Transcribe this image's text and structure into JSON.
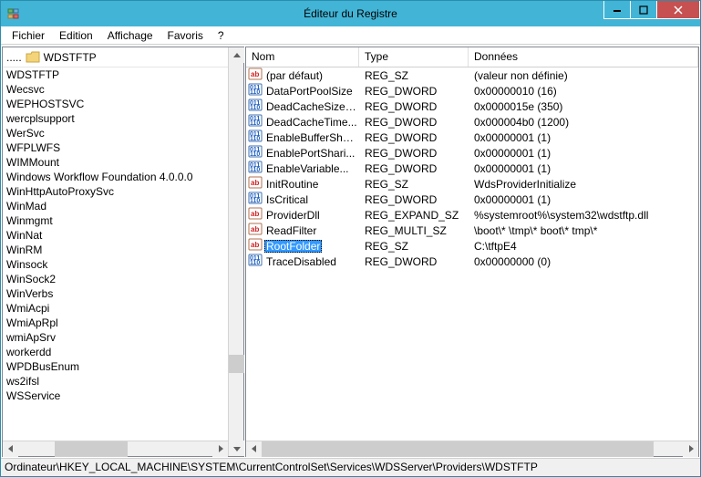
{
  "window": {
    "title": "Éditeur du Registre"
  },
  "menu": {
    "items": [
      "Fichier",
      "Edition",
      "Affichage",
      "Favoris",
      "?"
    ]
  },
  "tree": {
    "header_dots": ".....",
    "selected_key": "WDSTFTP",
    "nodes": [
      "WDSTFTP",
      "Wecsvc",
      "WEPHOSTSVC",
      "wercplsupport",
      "WerSvc",
      "WFPLWFS",
      "WIMMount",
      "Windows Workflow Foundation 4.0.0.0",
      "WinHttpAutoProxySvc",
      "WinMad",
      "Winmgmt",
      "WinNat",
      "WinRM",
      "Winsock",
      "WinSock2",
      "WinVerbs",
      "WmiAcpi",
      "WmiApRpl",
      "wmiApSrv",
      "workerdd",
      "WPDBusEnum",
      "ws2ifsl",
      "WSService"
    ]
  },
  "values": {
    "columns": {
      "name": "Nom",
      "type": "Type",
      "data": "Données"
    },
    "rows": [
      {
        "icon": "sz",
        "name": "(par défaut)",
        "type": "REG_SZ",
        "data": "(valeur non définie)",
        "selected": false
      },
      {
        "icon": "bin",
        "name": "DataPortPoolSize",
        "type": "REG_DWORD",
        "data": "0x00000010 (16)",
        "selected": false
      },
      {
        "icon": "bin",
        "name": "DeadCacheSizeL...",
        "type": "REG_DWORD",
        "data": "0x0000015e (350)",
        "selected": false
      },
      {
        "icon": "bin",
        "name": "DeadCacheTime...",
        "type": "REG_DWORD",
        "data": "0x000004b0 (1200)",
        "selected": false
      },
      {
        "icon": "bin",
        "name": "EnableBufferSha...",
        "type": "REG_DWORD",
        "data": "0x00000001 (1)",
        "selected": false
      },
      {
        "icon": "bin",
        "name": "EnablePortShari...",
        "type": "REG_DWORD",
        "data": "0x00000001 (1)",
        "selected": false
      },
      {
        "icon": "bin",
        "name": "EnableVariable...",
        "type": "REG_DWORD",
        "data": "0x00000001 (1)",
        "selected": false
      },
      {
        "icon": "sz",
        "name": "InitRoutine",
        "type": "REG_SZ",
        "data": "WdsProviderInitialize",
        "selected": false
      },
      {
        "icon": "bin",
        "name": "IsCritical",
        "type": "REG_DWORD",
        "data": "0x00000001 (1)",
        "selected": false
      },
      {
        "icon": "sz",
        "name": "ProviderDll",
        "type": "REG_EXPAND_SZ",
        "data": "%systemroot%\\system32\\wdstftp.dll",
        "selected": false
      },
      {
        "icon": "sz",
        "name": "ReadFilter",
        "type": "REG_MULTI_SZ",
        "data": "\\boot\\* \\tmp\\* boot\\* tmp\\*",
        "selected": false
      },
      {
        "icon": "sz",
        "name": "RootFolder",
        "type": "REG_SZ",
        "data": "C:\\tftpE4",
        "selected": true
      },
      {
        "icon": "bin",
        "name": "TraceDisabled",
        "type": "REG_DWORD",
        "data": "0x00000000 (0)",
        "selected": false
      }
    ]
  },
  "status": {
    "path": "Ordinateur\\HKEY_LOCAL_MACHINE\\SYSTEM\\CurrentControlSet\\Services\\WDSServer\\Providers\\WDSTFTP"
  }
}
